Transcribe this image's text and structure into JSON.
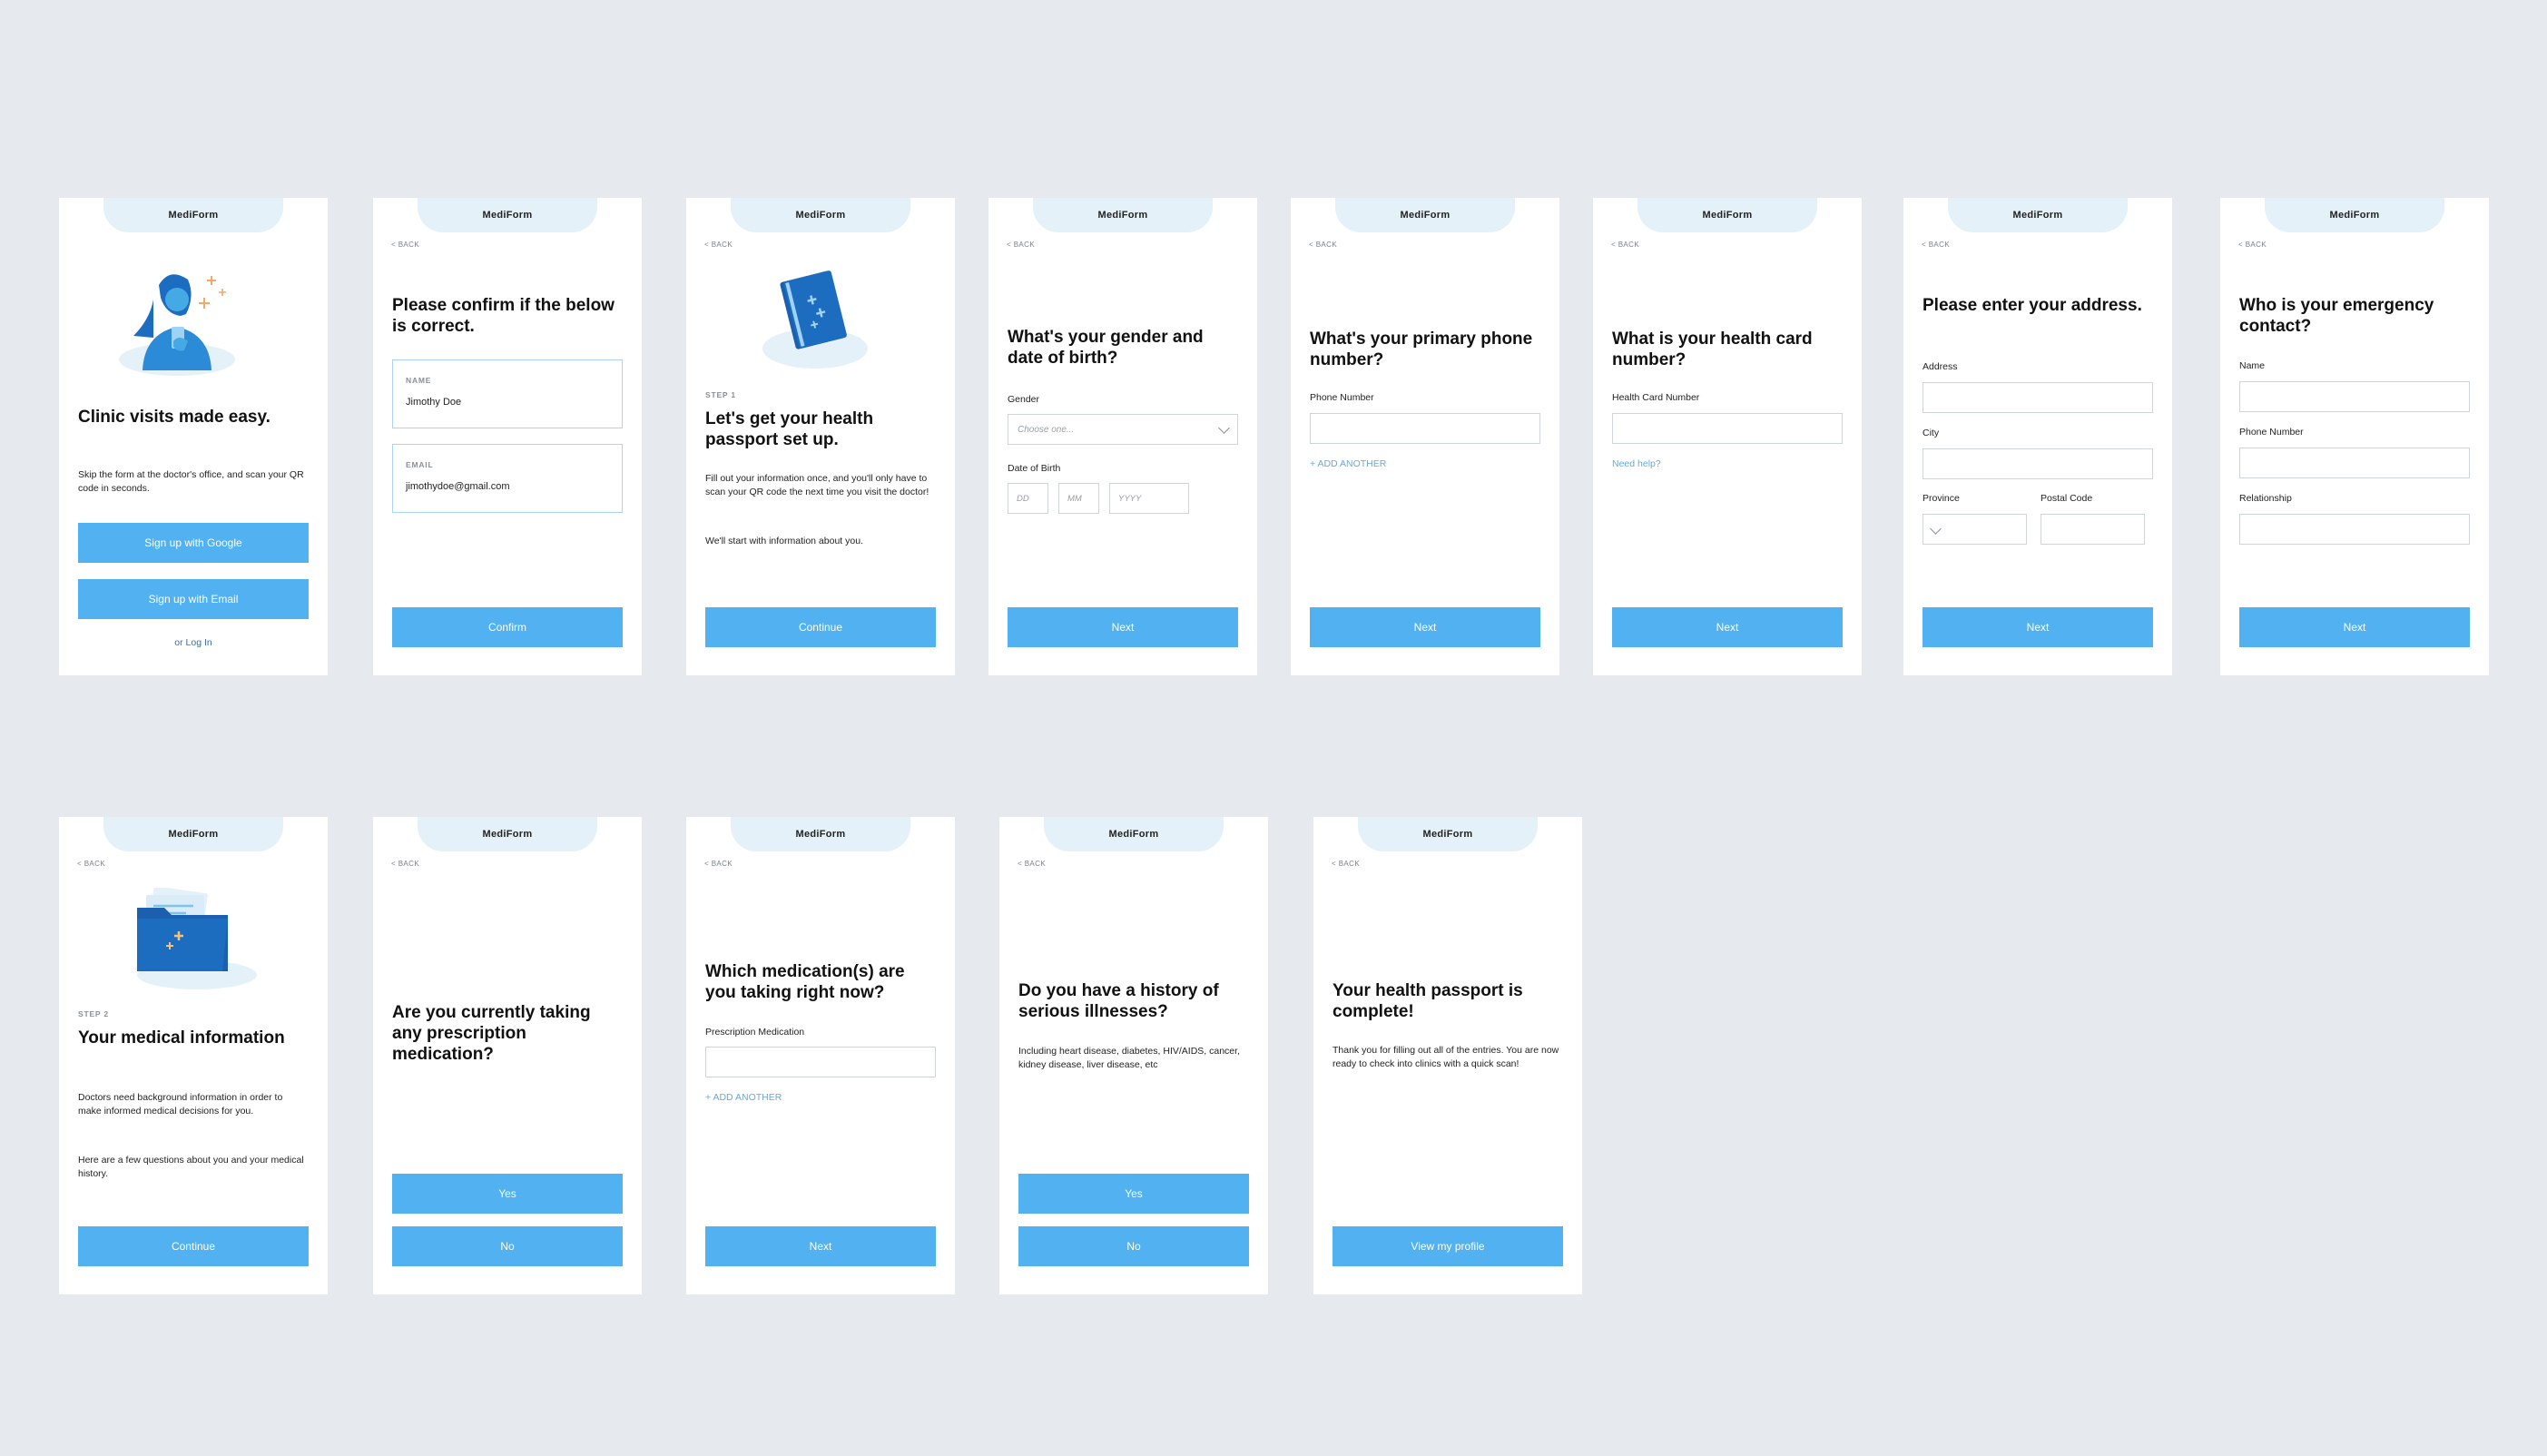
{
  "app_name": "MediForm",
  "back_label": "< BACK",
  "colors": {
    "primary": "#52b1f0",
    "tab": "#e4f1f8",
    "canvas": "#e6eaee",
    "illustration": "#1c6cc0"
  },
  "s1": {
    "illustration": "woman-with-phone-icon",
    "heading": "Clinic visits made easy.",
    "body": "Skip the form at the doctor's office, and scan your QR code in seconds.",
    "google_btn": "Sign up with Google",
    "email_btn": "Sign up with Email",
    "login": "or Log In"
  },
  "s2": {
    "heading": "Please confirm if the below is correct.",
    "name_label": "NAME",
    "name_value": "Jimothy Doe",
    "email_label": "EMAIL",
    "email_value": "jimothydoe@gmail.com",
    "button": "Confirm"
  },
  "s3": {
    "illustration": "health-passport-book-icon",
    "step": "STEP 1",
    "heading": "Let's get your health passport set up.",
    "body1": "Fill out your information once, and you'll only have to scan your QR code the next time you visit the doctor!",
    "body2": "We'll start with information about you.",
    "button": "Continue"
  },
  "s4": {
    "heading": "What's your gender and date of birth?",
    "gender_label": "Gender",
    "gender_placeholder": "Choose one...",
    "dob_label": "Date of Birth",
    "dd": "DD",
    "mm": "MM",
    "yyyy": "YYYY",
    "button": "Next"
  },
  "s5": {
    "heading": "What's your primary phone number?",
    "phone_label": "Phone Number",
    "add_another": "+ ADD ANOTHER",
    "button": "Next"
  },
  "s6": {
    "heading": "What is your health card number?",
    "card_label": "Health Card Number",
    "help": "Need help?",
    "button": "Next"
  },
  "s7": {
    "heading": "Please enter your address.",
    "address_label": "Address",
    "city_label": "City",
    "province_label": "Province",
    "postal_label": "Postal Code",
    "button": "Next"
  },
  "s8": {
    "heading": "Who is your emergency contact?",
    "name_label": "Name",
    "phone_label": "Phone Number",
    "relationship_label": "Relationship",
    "button": "Next"
  },
  "s9": {
    "illustration": "medical-folder-icon",
    "step": "STEP 2",
    "heading": "Your medical information",
    "body1": "Doctors need background information in order to make informed medical decisions for you.",
    "body2": "Here are a few questions about you and your medical history.",
    "button": "Continue"
  },
  "s10": {
    "heading": "Are you currently taking any prescription medication?",
    "yes": "Yes",
    "no": "No"
  },
  "s11": {
    "heading": "Which medication(s) are you taking right now?",
    "med_label": "Prescription Medication",
    "add_another": "+ ADD ANOTHER",
    "button": "Next"
  },
  "s12": {
    "heading": "Do you have a history of serious illnesses?",
    "body": "Including heart disease, diabetes, HIV/AIDS, cancer, kidney disease, liver disease, etc",
    "yes": "Yes",
    "no": "No"
  },
  "s13": {
    "heading": "Your health passport is complete!",
    "body": "Thank you for filling out all of the entries. You are now ready to check into clinics with a quick scan!",
    "button": "View my profile"
  }
}
